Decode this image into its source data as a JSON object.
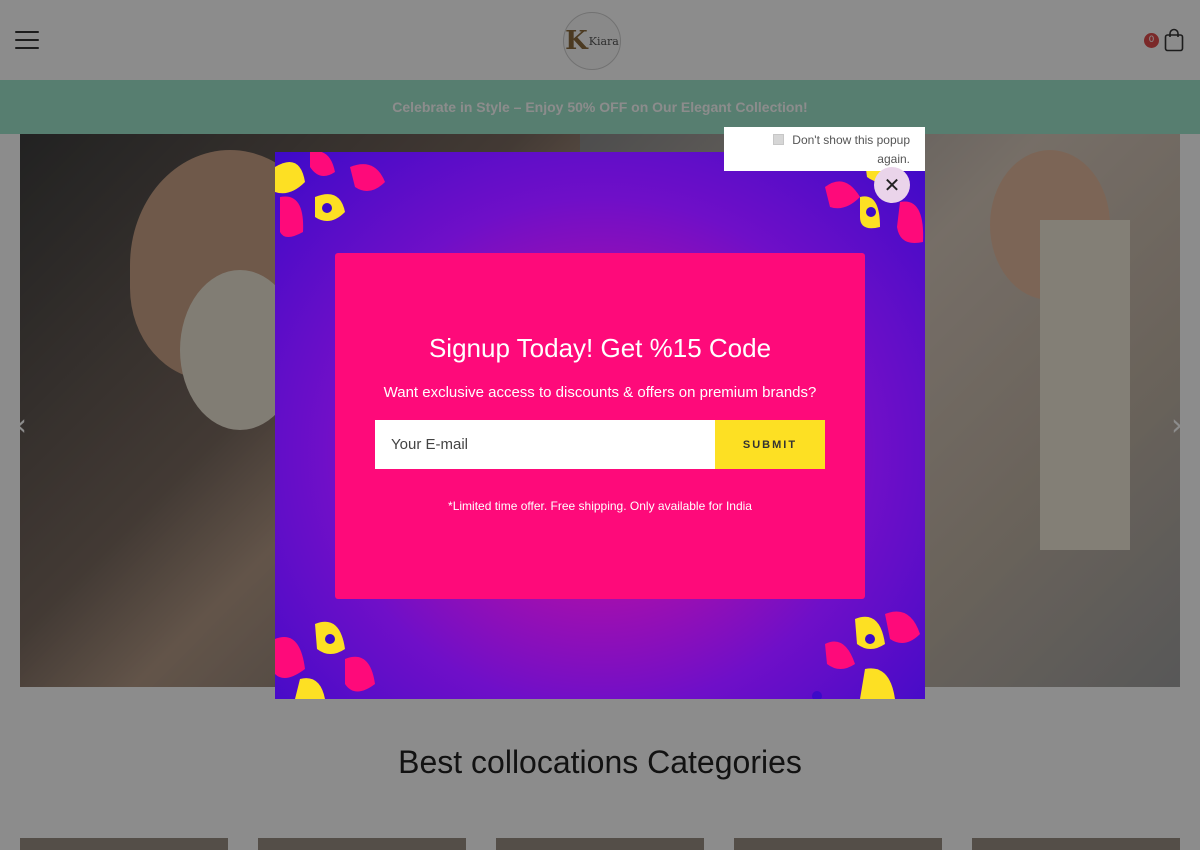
{
  "header": {
    "logo_text": "Kiara",
    "cart_count": "0"
  },
  "announcement": {
    "text": "Celebrate in Style – Enjoy 50% OFF on Our Elegant Collection!"
  },
  "hero": {
    "prev_icon": "chevron-left-icon",
    "next_icon": "chevron-right-icon",
    "prev_glyph": "‹",
    "next_glyph": "›"
  },
  "section": {
    "title": "Best collocations Categories"
  },
  "popup": {
    "title": "Signup Today! Get %15 Code",
    "subtitle": "Want exclusive access to discounts & offers on premium brands?",
    "email_placeholder": "Your E-mail",
    "submit_label": "SUBMIT",
    "note": "*Limited time offer. Free shipping. Only available for India",
    "close_glyph": "✕",
    "dont_show_label": "Don't show this popup again."
  },
  "colors": {
    "announcement_bg": "#9fe6cd",
    "popup_card": "#fe0a7a",
    "submit_button": "#fde023",
    "cart_badge": "#e04b4b"
  }
}
